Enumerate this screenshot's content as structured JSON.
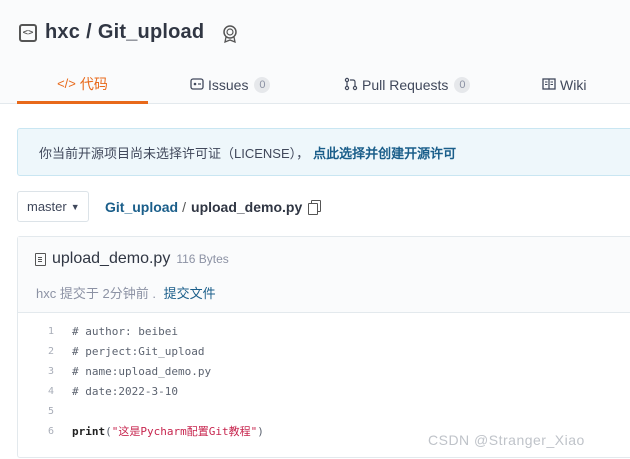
{
  "repo": {
    "owner": "hxc",
    "separator": "/",
    "name": "Git_upload"
  },
  "tabs": [
    {
      "label": "代码",
      "icon": "code-icon",
      "active": true
    },
    {
      "label": "Issues",
      "count": "0",
      "icon": "issues-icon"
    },
    {
      "label": "Pull Requests",
      "count": "0",
      "icon": "pull-request-icon"
    },
    {
      "label": "Wiki",
      "icon": "wiki-icon"
    }
  ],
  "license_notice": {
    "text": "你当前开源项目尚未选择许可证（LICENSE），",
    "link": "点此选择并创建开源许可"
  },
  "branch": {
    "selected": "master"
  },
  "breadcrumb": {
    "repo": "Git_upload",
    "separator": "/",
    "file": "upload_demo.py"
  },
  "file": {
    "name": "upload_demo.py",
    "size": "116 Bytes",
    "commit_author": "hxc",
    "commit_text": "提交于 2分钟前 .",
    "commit_link": "提交文件"
  },
  "code_lines": [
    {
      "num": "1",
      "text": "# author: beibei"
    },
    {
      "num": "2",
      "text": "# perject:Git_upload"
    },
    {
      "num": "3",
      "text": "# name:upload_demo.py"
    },
    {
      "num": "4",
      "text": "# date:2022-3-10"
    },
    {
      "num": "5",
      "text": ""
    },
    {
      "num": "6",
      "keyword": "print",
      "open": "(",
      "string": "\"这是Pycharm配置Git教程\"",
      "close": ")"
    }
  ],
  "watermark": "CSDN @Stranger_Xiao",
  "colors": {
    "accent": "#e8691a",
    "link": "#1a5e8a",
    "string": "#c7254e"
  }
}
